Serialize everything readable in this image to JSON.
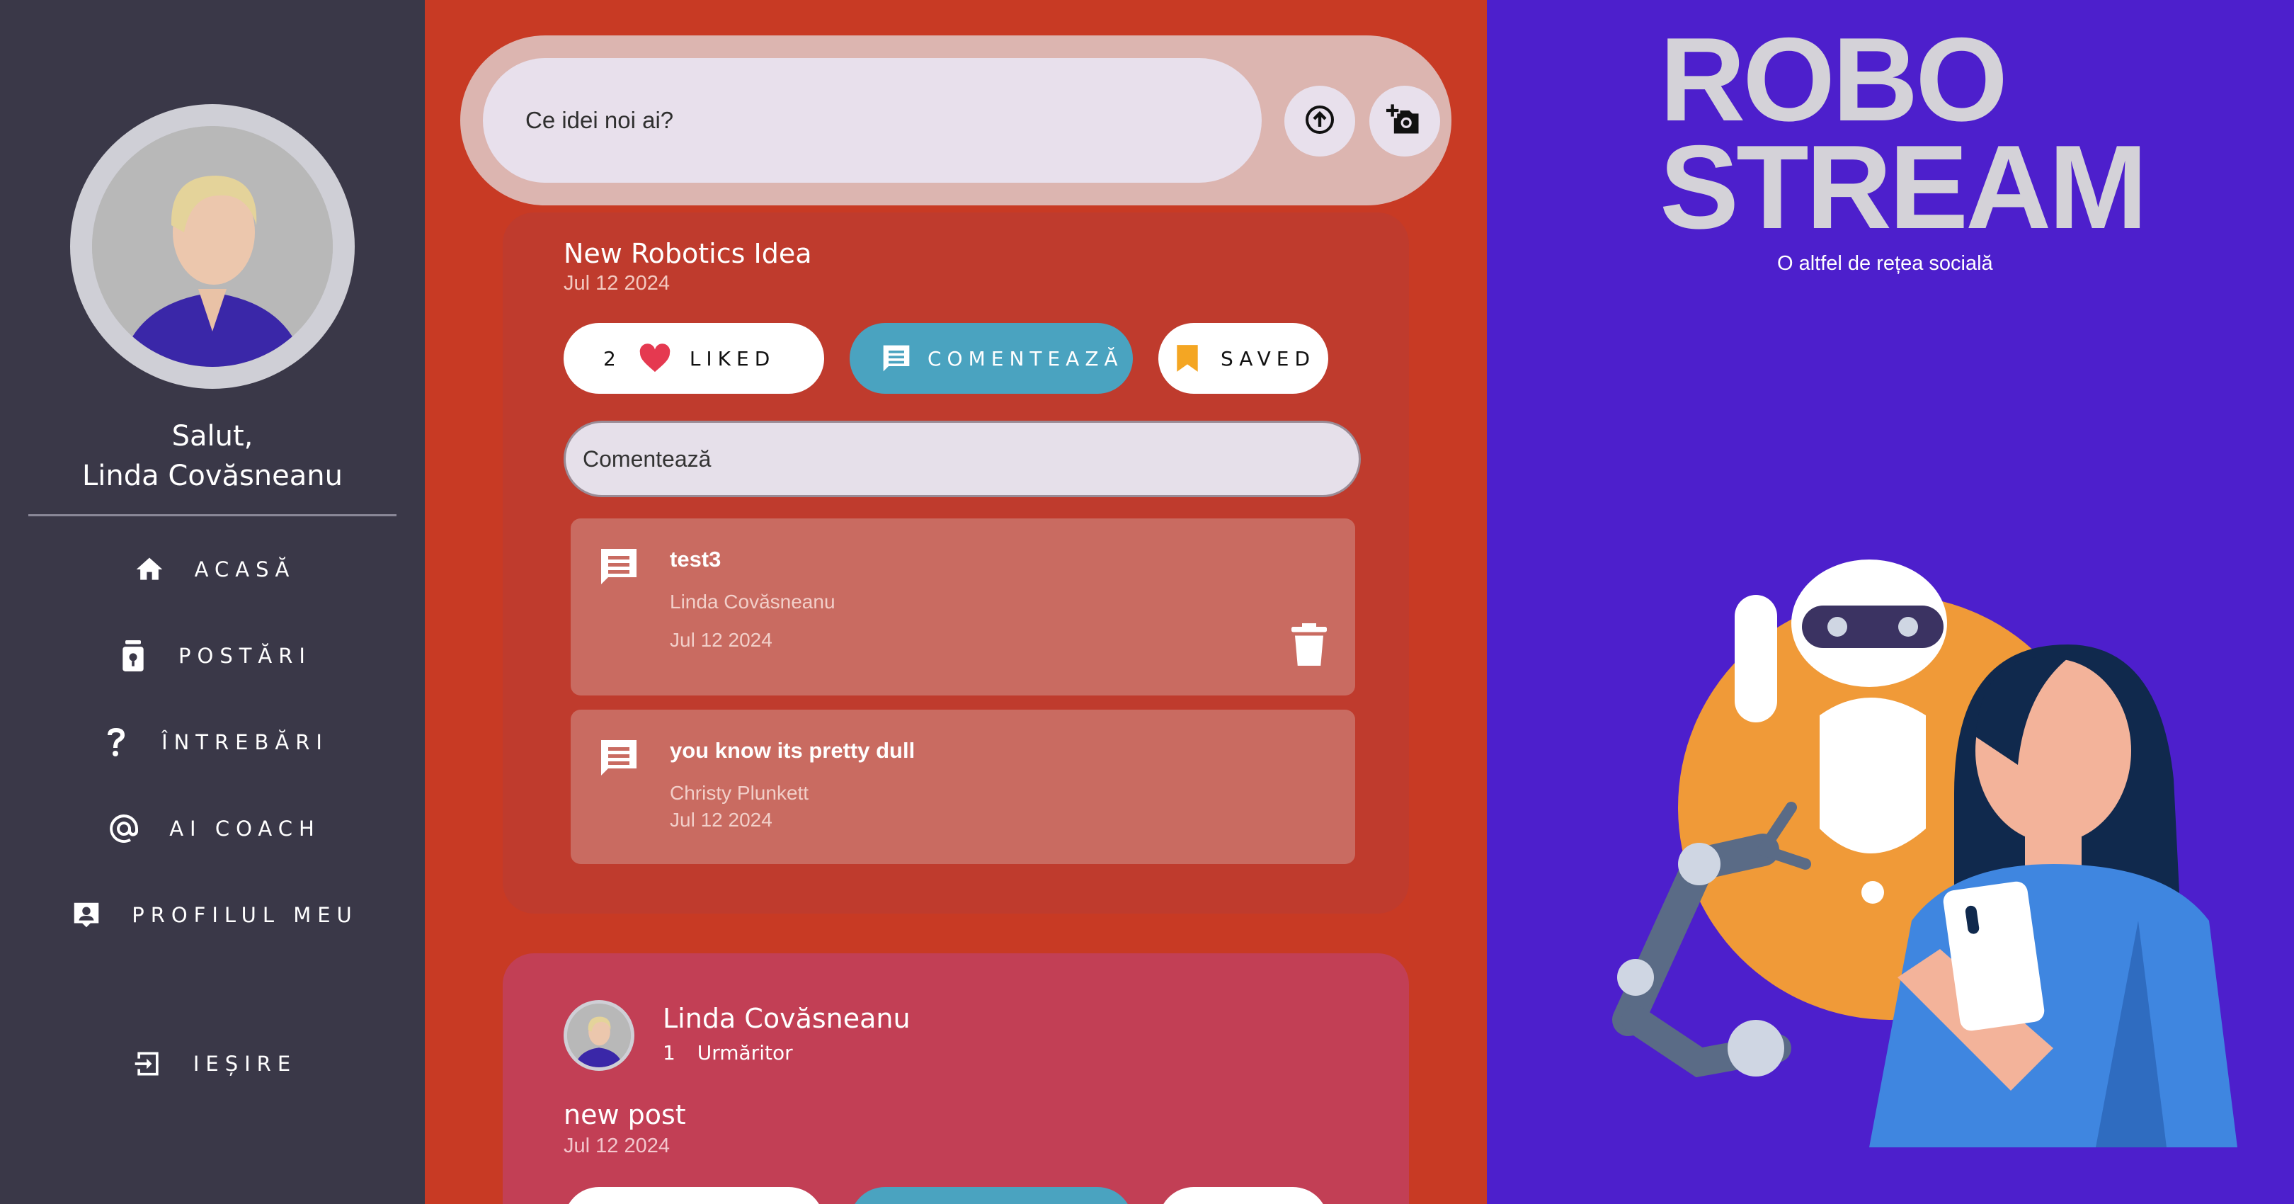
{
  "colors": {
    "sidebar_bg": "#3a3848",
    "feed_bg": "#c83a24",
    "post_card_bg": "#bf3b2d",
    "comment_box_bg": "#c96b61",
    "second_post_bg": "#c23f55",
    "accent_comment": "#4aa3c0",
    "like_heart": "#e53950",
    "saved_bookmark": "#f4a623",
    "brand_bg": "#4d1fcc"
  },
  "sidebar": {
    "greeting_line1": "Salut,",
    "greeting_line2": "Linda Covăsneanu",
    "nav": [
      {
        "label": "ACASĂ",
        "icon": "home-icon"
      },
      {
        "label": "POSTĂRI",
        "icon": "posts-icon"
      },
      {
        "label": "ÎNTREBĂRI",
        "icon": "question-icon"
      },
      {
        "label": "AI COACH",
        "icon": "at-icon"
      },
      {
        "label": "PROFILUL MEU",
        "icon": "profile-icon"
      }
    ],
    "logout": {
      "label": "IEȘIRE",
      "icon": "logout-icon"
    }
  },
  "composer": {
    "placeholder": "Ce idei noi ai?",
    "upload_icon": "upload-icon",
    "camera_icon": "add-photo-icon"
  },
  "post": {
    "title": "New Robotics Idea",
    "date": "Jul 12 2024",
    "like_count": "2",
    "like_label": "LIKED",
    "comment_label": "COMENTEAZĂ",
    "saved_label": "SAVED",
    "comment_placeholder": "Comentează",
    "comments": [
      {
        "text": "test3",
        "author": "Linda Covăsneanu",
        "date": "Jul 12 2024",
        "deletable": true
      },
      {
        "text": "you know its pretty dull",
        "author": "Christy Plunkett",
        "date": "Jul 12 2024",
        "deletable": false
      }
    ]
  },
  "post2": {
    "author": "Linda Covăsneanu",
    "followers_count": "1",
    "followers_label": "Urmăritor",
    "title": "new post",
    "date": "Jul 12 2024"
  },
  "brand": {
    "title_line1": "ROBO",
    "title_line2": "STREAM",
    "subtitle": "O altfel de rețea socială"
  }
}
